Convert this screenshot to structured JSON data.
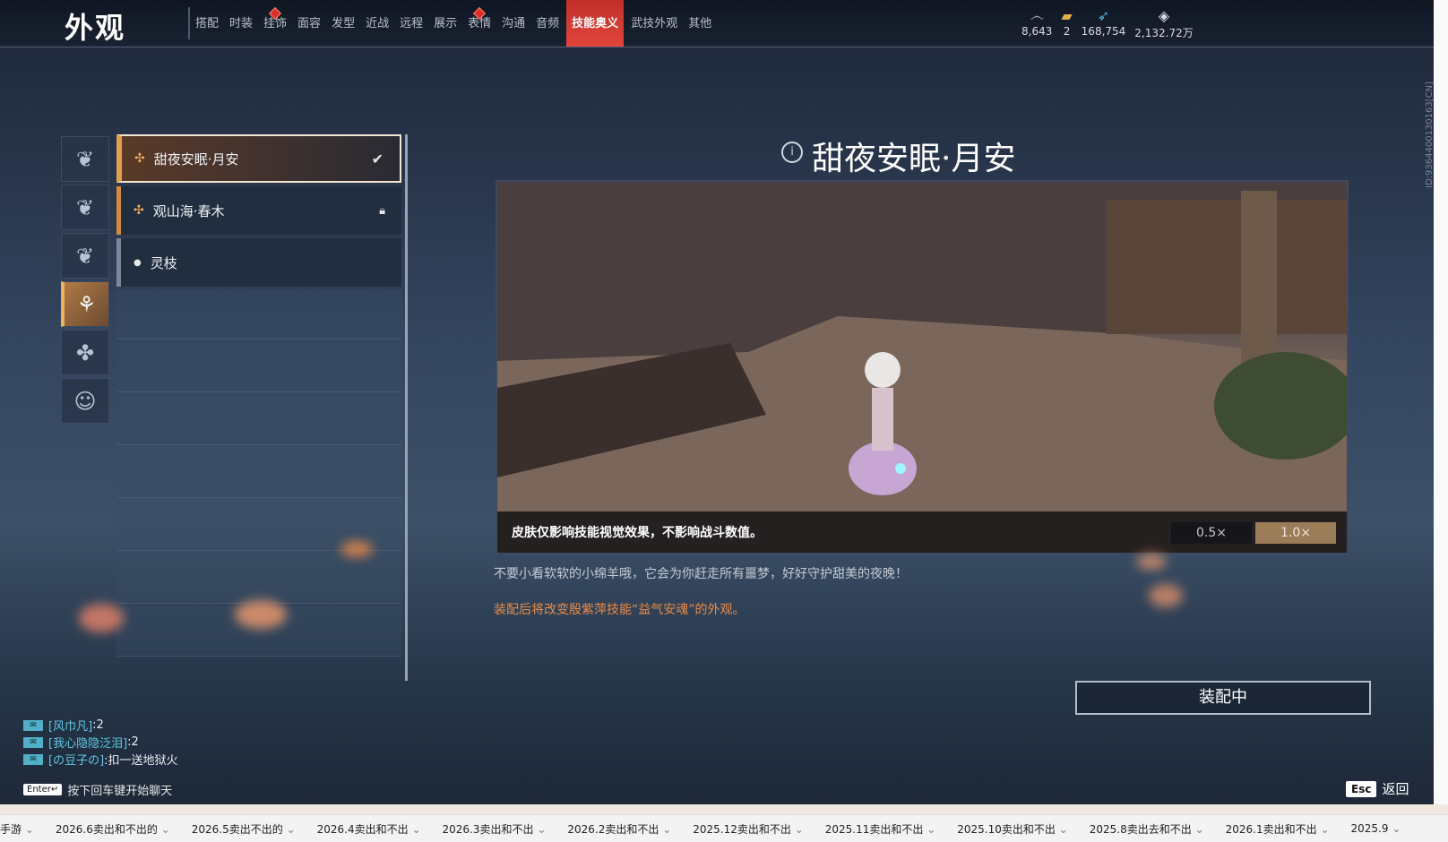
{
  "app_title": "外观",
  "tabs": [
    "搭配",
    "时装",
    "挂饰",
    "面容",
    "发型",
    "近战",
    "远程",
    "展示",
    "表情",
    "沟通",
    "音频",
    "技能奥义",
    "武技外观",
    "其他"
  ],
  "active_tab": "技能奥义",
  "currencies": [
    {
      "icon": "spiral-icon",
      "value": "8,643"
    },
    {
      "icon": "ticket-icon",
      "value": "2"
    },
    {
      "icon": "feather-icon",
      "value": "168,754"
    },
    {
      "icon": "diamond-icon",
      "value": "2,132.72万"
    }
  ],
  "side_id": "ID:9364400130163[CN]",
  "skins": [
    {
      "name": "甜夜安眠·月安",
      "state": "equipped"
    },
    {
      "name": "观山海·春木",
      "state": "locked"
    },
    {
      "name": "灵枝",
      "state": "default"
    }
  ],
  "selected": {
    "title": "甜夜安眠·月安",
    "preview_note": "皮肤仅影响技能视觉效果，不影响战斗数值。",
    "speed_options": [
      "0.5×",
      "1.0×"
    ],
    "description": "不要小看软软的小绵羊哦，它会为你赶走所有噩梦，好好守护甜美的夜晚！",
    "effect": "装配后将改变殷紫萍技能“益气安魂”的外观。",
    "equip_button": "装配中"
  },
  "chat": [
    {
      "name": "[风巾凡]",
      "text": ":2"
    },
    {
      "name": "[我心隐隐泛泪]",
      "text": ":2"
    },
    {
      "name": "[の豆子の]",
      "text": ":扣一送地狱火"
    }
  ],
  "chat_hint": {
    "key": "Enter↵",
    "text": "按下回车键开始聊天"
  },
  "esc": {
    "key": "Esc",
    "label": "返回"
  },
  "sheet_tabs": [
    "手游",
    "2026.6卖出和不出的",
    "2026.5卖出不出的",
    "2026.4卖出和不出",
    "2026.3卖出和不出",
    "2026.2卖出和不出",
    "2025.12卖出和不出",
    "2025.11卖出和不出",
    "2025.10卖出和不出",
    "2025.8卖出去和不出",
    "2026.1卖出和不出",
    "2025.9"
  ]
}
